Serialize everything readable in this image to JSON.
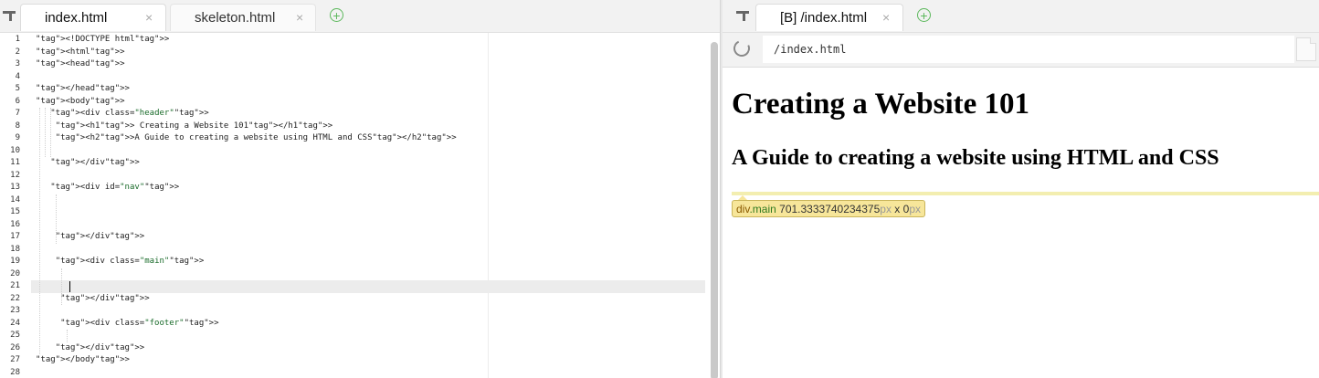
{
  "editor_tabs": [
    {
      "label": "index.html",
      "close": "×",
      "active": true
    },
    {
      "label": "skeleton.html",
      "close": "×",
      "active": false
    }
  ],
  "add_tab": "+",
  "preview_tabs": [
    {
      "label": "[B] /index.html",
      "close": "×",
      "active": true
    }
  ],
  "code_lines": [
    "<!DOCTYPE html>",
    "<html>",
    "<head>",
    "",
    "</head>",
    "<body>",
    "   <div class=\"header\">",
    "    <h1> Creating a Website 101</h1>",
    "    <h2>A Guide to creating a website using HTML and CSS</h2>",
    "",
    "   </div>",
    "",
    "   <div id=\"nav\">",
    "",
    "",
    "",
    "    </div>",
    "",
    "    <div class=\"main\">",
    "",
    "",
    "     </div>",
    "",
    "     <div class=\"footer\">",
    "",
    "    </div>",
    "</body>",
    ""
  ],
  "line_numbers": [
    "1",
    "2",
    "3",
    "4",
    "5",
    "6",
    "7",
    "8",
    "9",
    "10",
    "11",
    "12",
    "13",
    "14",
    "15",
    "16",
    "17",
    "18",
    "19",
    "20",
    "21",
    "22",
    "23",
    "24",
    "25",
    "26",
    "27",
    "28"
  ],
  "current_line": 21,
  "preview": {
    "url": "/index.html",
    "h1": "Creating a Website 101",
    "h2": "A Guide to creating a website using HTML and CSS",
    "inspect_tooltip": {
      "element": "div",
      "class": ".main",
      "width": "701.3333740234375",
      "unit1": "px",
      "sep": " x ",
      "height": "0",
      "unit2": "px"
    }
  },
  "colors": {
    "tag": "#2a40a8",
    "string": "#1a6b2a",
    "add_icon": "#5cb85c",
    "tooltip_bg": "#f7e69a"
  }
}
